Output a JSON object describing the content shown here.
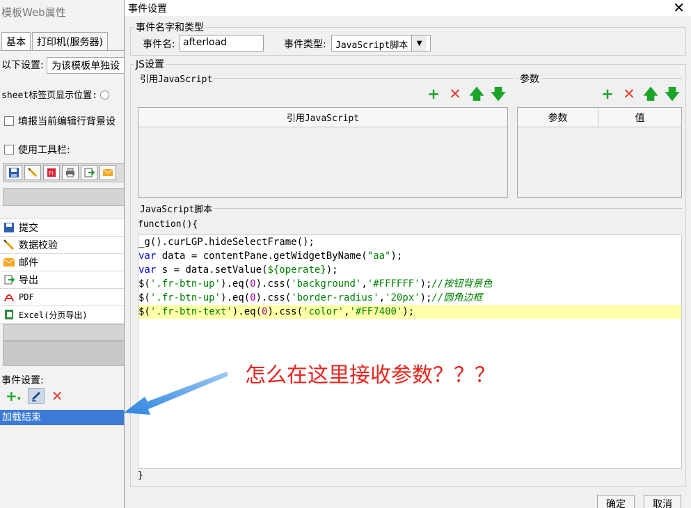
{
  "left_panel": {
    "title": "模板Web属性",
    "tabs": [
      "基本",
      "打印机(服务器)"
    ],
    "settings_prefix": "以下设置:",
    "settings_select": "为该模板单独设",
    "sheet_tab_label": "sheet标签页显示位置:",
    "checkbox_bg": "填报当前编辑行背景设",
    "checkbox_toolbar": "使用工具栏:",
    "buttons": [
      {
        "icon": "save-icon",
        "label": "提交"
      },
      {
        "icon": "pencil-check-icon",
        "label": "数据校验"
      },
      {
        "icon": "envelope-icon",
        "label": "邮件"
      },
      {
        "icon": "export-icon",
        "label": "导出"
      },
      {
        "icon": "pdf-icon",
        "label": "PDF"
      },
      {
        "icon": "excel-icon",
        "label": "Excel(分页导出)"
      }
    ],
    "event_label": "事件设置:",
    "event_item": "加载结束"
  },
  "dialog": {
    "title": "事件设置",
    "name_group": "事件名字和类型",
    "event_name_label": "事件名:",
    "event_name_value": "afterload",
    "event_type_label": "事件类型:",
    "event_type_value": "JavaScript脚本",
    "js_group": "JS设置",
    "ref_js_group": "引用JavaScript",
    "params_group": "参数",
    "ref_js_header": "引用JavaScript",
    "param_headers": [
      "参数",
      "值"
    ],
    "script_group": "JavaScript脚本",
    "code_open": "function(){",
    "code_close": "}",
    "ok_button": "确定",
    "cancel_button": "取消"
  },
  "code_lines": [
    "_g().curLGP.hideSelectFrame();",
    "var data = contentPane.getWidgetByName(\"aa\");",
    "var s = data.setValue(${operate});",
    "$('.fr-btn-up').eq(0).css('background','#FFFFFF');//按钮背景色",
    "$('.fr-btn-up').eq(0).css('border-radius','20px');//圆角边框",
    "$('.fr-btn-text').eq(0).css('color','#FF7400');"
  ],
  "annotation": "怎么在这里接收参数？？？",
  "colors": {
    "accent_green": "#1aa52a",
    "accent_red": "#e23b2e",
    "annotation_red": "#e8251d",
    "selection_blue": "#3b7bd5",
    "highlight_line": "#ffffa8"
  }
}
